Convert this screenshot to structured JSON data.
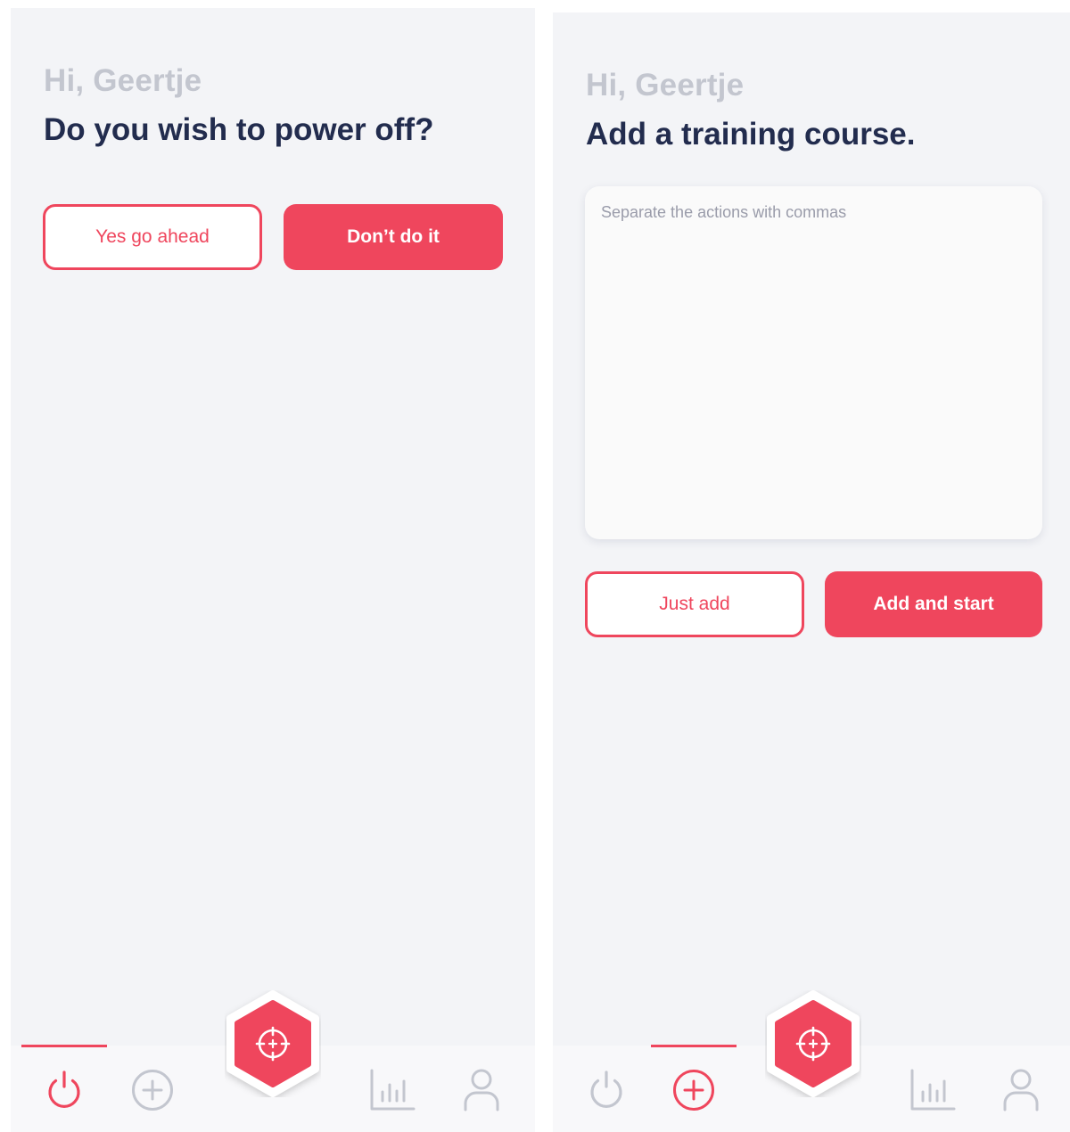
{
  "colors": {
    "accent": "#ef465d",
    "heading": "#222c4e",
    "muted": "#c3c6cf",
    "background": "#f3f4f7"
  },
  "screens": [
    {
      "greeting": "Hi, Geertje",
      "title": "Do you wish to power off?",
      "buttons": {
        "secondary": "Yes go ahead",
        "primary": "Don’t do it"
      },
      "nav": {
        "active": "power",
        "items": [
          "power-icon",
          "plus-circle-icon",
          "bar-chart-icon",
          "user-icon"
        ],
        "fab_icon": "crosshair-icon"
      }
    },
    {
      "greeting": "Hi, Geertje",
      "title": "Add a training course.",
      "textarea": {
        "placeholder": "Separate the actions with commas"
      },
      "buttons": {
        "secondary": "Just add",
        "primary": "Add and start"
      },
      "nav": {
        "active": "add",
        "items": [
          "power-icon",
          "plus-circle-icon",
          "bar-chart-icon",
          "user-icon"
        ],
        "fab_icon": "crosshair-icon"
      }
    }
  ]
}
